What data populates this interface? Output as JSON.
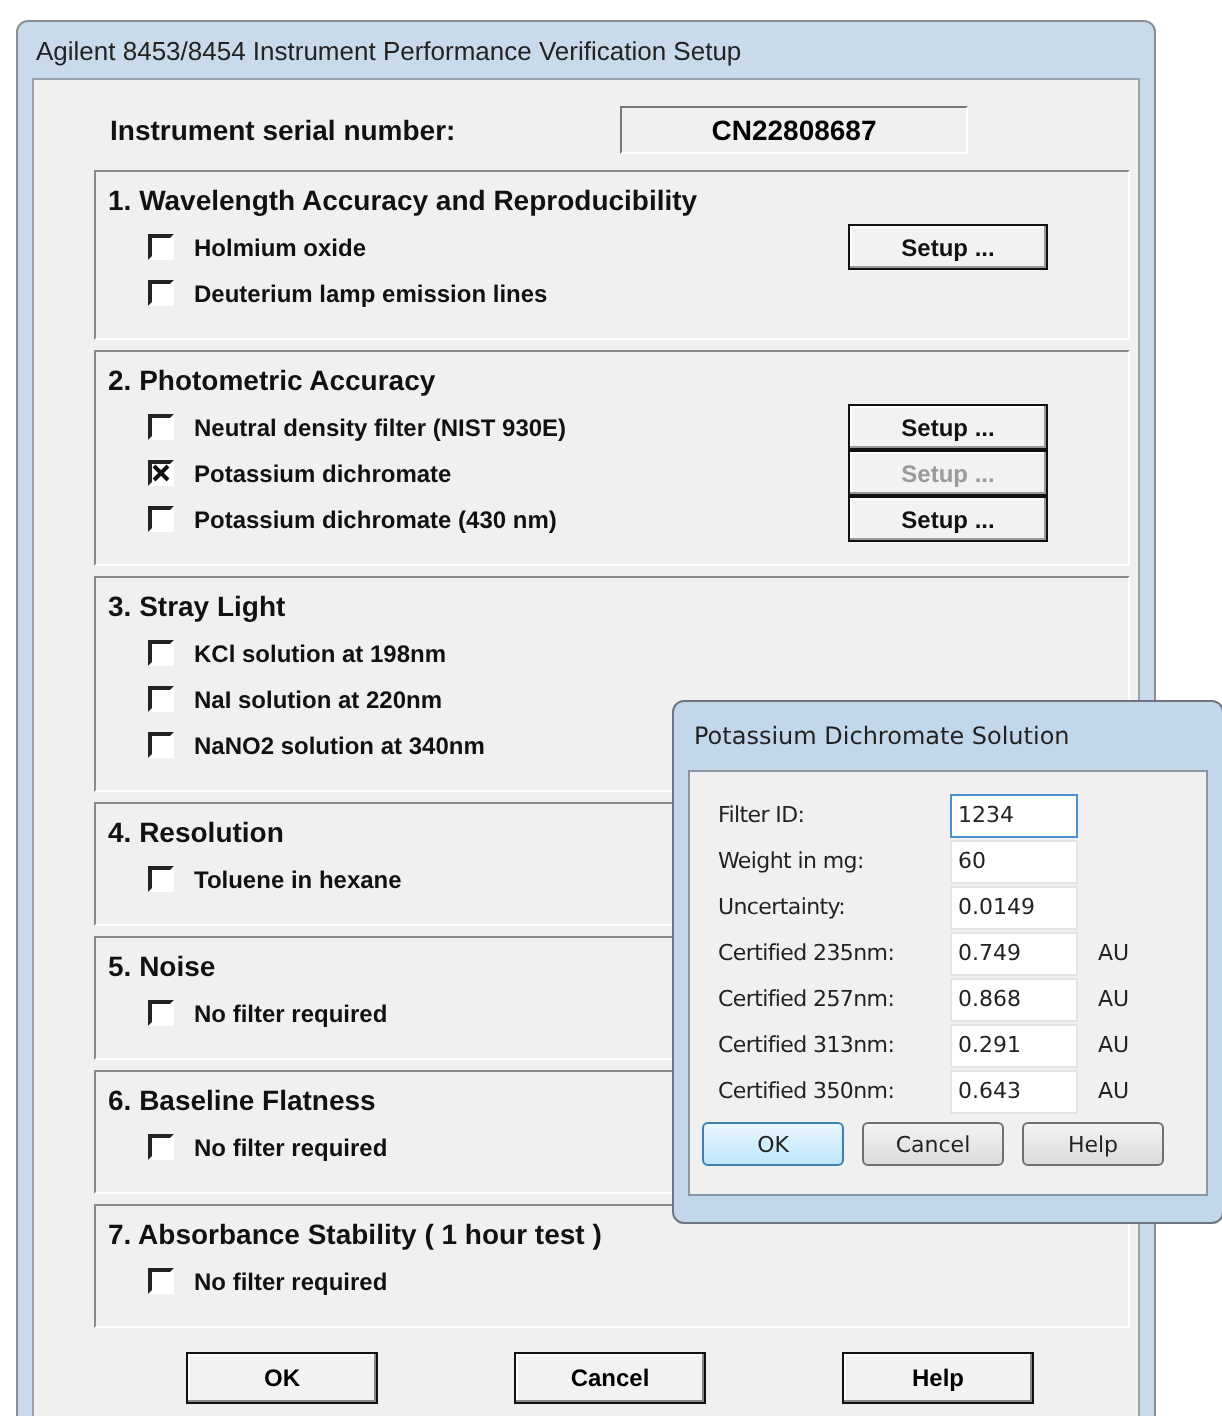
{
  "window": {
    "title": "Agilent 8453/8454 Instrument Performance Verification Setup"
  },
  "serial": {
    "label": "Instrument serial number:",
    "value": "CN22808687"
  },
  "sections": [
    {
      "title": "1. Wavelength Accuracy and Reproducibility",
      "items": [
        {
          "label": "Holmium oxide",
          "checked": false,
          "button": {
            "label": "Setup ...",
            "disabled": false
          }
        },
        {
          "label": "Deuterium lamp emission lines",
          "checked": false
        }
      ]
    },
    {
      "title": "2. Photometric Accuracy",
      "items": [
        {
          "label": "Neutral density filter (NIST 930E)",
          "checked": false,
          "button": {
            "label": "Setup ...",
            "disabled": false
          }
        },
        {
          "label": "Potassium dichromate",
          "checked": true,
          "button": {
            "label": "Setup ...",
            "disabled": true
          }
        },
        {
          "label": "Potassium dichromate (430 nm)",
          "checked": false,
          "button": {
            "label": "Setup ...",
            "disabled": false
          }
        }
      ]
    },
    {
      "title": "3. Stray Light",
      "items": [
        {
          "label": "KCl solution at 198nm",
          "checked": false
        },
        {
          "label": "NaI solution at 220nm",
          "checked": false
        },
        {
          "label": "NaNO2 solution at 340nm",
          "checked": false
        }
      ]
    },
    {
      "title": "4. Resolution",
      "items": [
        {
          "label": "Toluene in hexane",
          "checked": false
        }
      ]
    },
    {
      "title": "5. Noise",
      "items": [
        {
          "label": "No filter required",
          "checked": false
        }
      ]
    },
    {
      "title": "6. Baseline Flatness",
      "items": [
        {
          "label": "No filter required",
          "checked": false
        }
      ]
    },
    {
      "title": "7. Absorbance Stability ( 1 hour test )",
      "items": [
        {
          "label": "No filter required",
          "checked": false
        }
      ]
    }
  ],
  "buttons": [
    "OK",
    "Cancel",
    "Help"
  ],
  "popup": {
    "title": "Potassium Dichromate Solution",
    "fields": [
      {
        "label": "Filter ID:",
        "value": "1234",
        "focused": true
      },
      {
        "label": "Weight in mg:",
        "value": "60",
        "focused": false
      },
      {
        "label": "Uncertainty:",
        "value": "0.0149",
        "focused": false
      },
      {
        "label": "Certified 235nm:",
        "value": "0.749",
        "unit": "AU",
        "focused": false
      },
      {
        "label": "Certified 257nm:",
        "value": "0.868",
        "unit": "AU",
        "focused": false
      },
      {
        "label": "Certified 313nm:",
        "value": "0.291",
        "unit": "AU",
        "focused": false
      },
      {
        "label": "Certified 350nm:",
        "value": "0.643",
        "unit": "AU",
        "focused": false
      }
    ],
    "buttons": [
      {
        "label": "OK",
        "default": true
      },
      {
        "label": "Cancel",
        "default": false
      },
      {
        "label": "Help",
        "default": false
      }
    ]
  }
}
